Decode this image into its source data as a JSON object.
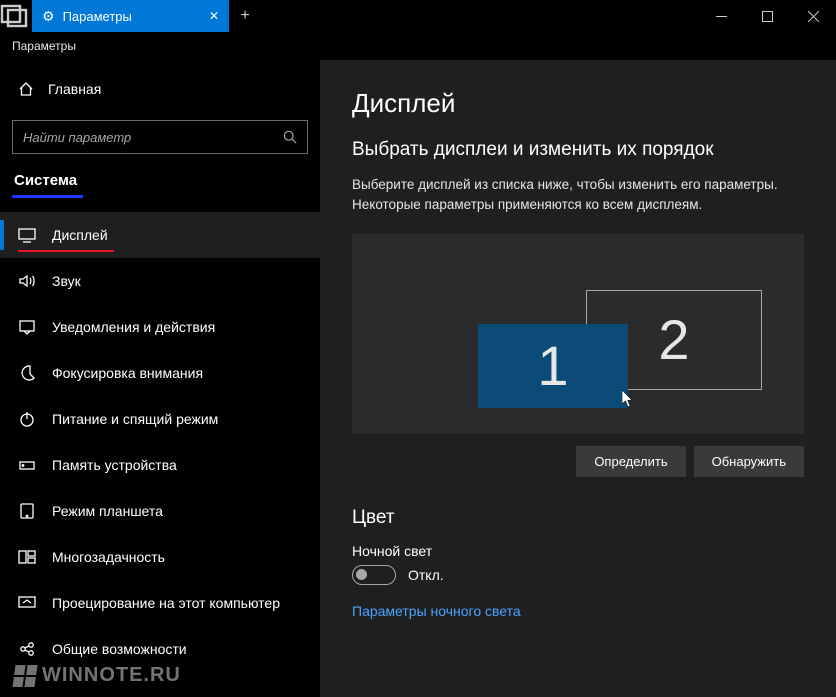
{
  "titlebar": {
    "tab_title": "Параметры",
    "subheader": "Параметры"
  },
  "sidebar": {
    "home": "Главная",
    "search_placeholder": "Найти параметр",
    "category": "Система",
    "items": [
      {
        "label": "Дисплей"
      },
      {
        "label": "Звук"
      },
      {
        "label": "Уведомления и действия"
      },
      {
        "label": "Фокусировка внимания"
      },
      {
        "label": "Питание и спящий режим"
      },
      {
        "label": "Память устройства"
      },
      {
        "label": "Режим планшета"
      },
      {
        "label": "Многозадачность"
      },
      {
        "label": "Проецирование на этот компьютер"
      },
      {
        "label": "Общие возможности"
      }
    ]
  },
  "main": {
    "title": "Дисплей",
    "arrange_heading": "Выбрать дисплеи и изменить их порядок",
    "arrange_desc": "Выберите дисплей из списка ниже, чтобы изменить его параметры. Некоторые параметры применяются ко всем дисплеям.",
    "display1": "1",
    "display2": "2",
    "identify_btn": "Определить",
    "detect_btn": "Обнаружить",
    "color_heading": "Цвет",
    "night_light_label": "Ночной свет",
    "toggle_state": "Откл.",
    "night_light_link": "Параметры ночного света"
  },
  "watermark": "WINNOTE.RU"
}
